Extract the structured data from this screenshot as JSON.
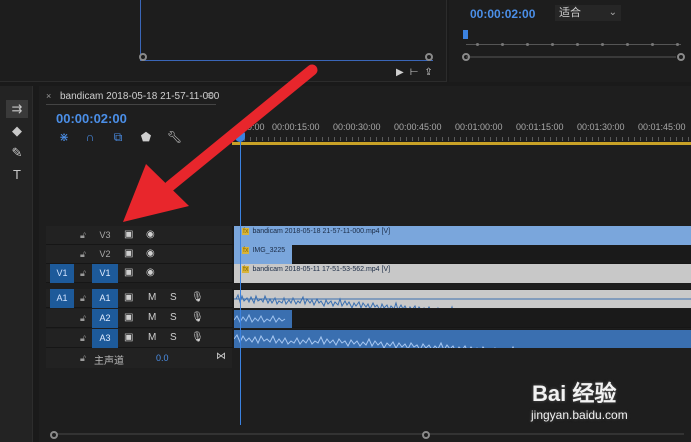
{
  "program": {
    "timecode": "00:00:02:00",
    "fit_label": "适合"
  },
  "sequence": {
    "tab_close": "×",
    "name": "bandicam 2018-05-18 21-57-11-000",
    "menu": "≡",
    "timecode": "00:00:02:00"
  },
  "ruler": [
    "00:00",
    "00:00:15:00",
    "00:00:30:00",
    "00:00:45:00",
    "00:01:00:00",
    "00:01:15:00",
    "00:01:30:00",
    "00:01:45:00"
  ],
  "video_tracks": [
    {
      "name": "V3",
      "clip": "bandicam 2018-05-18 21-57-11-000.mp4 [V]"
    },
    {
      "name": "V2",
      "clip": "IMG_3225"
    },
    {
      "name": "V1",
      "target": "V1",
      "clip": "bandicam 2018-05-11 17-51-53-562.mp4 [V]"
    }
  ],
  "audio_tracks": [
    {
      "name": "A1",
      "target": "A1"
    },
    {
      "name": "A2"
    },
    {
      "name": "A3"
    }
  ],
  "track_buttons": {
    "mute": "M",
    "solo": "S"
  },
  "master": {
    "label": "主声道",
    "value": "0.0"
  },
  "fx_badge": "fx",
  "watermark": {
    "brand": "Bai 经验",
    "url": "jingyan.baidu.com"
  },
  "colors": {
    "accent": "#4b8fe8",
    "video_clip": "#7aa6dc",
    "audio_clip": "#3a6fb0",
    "arrow": "#e8262c"
  }
}
